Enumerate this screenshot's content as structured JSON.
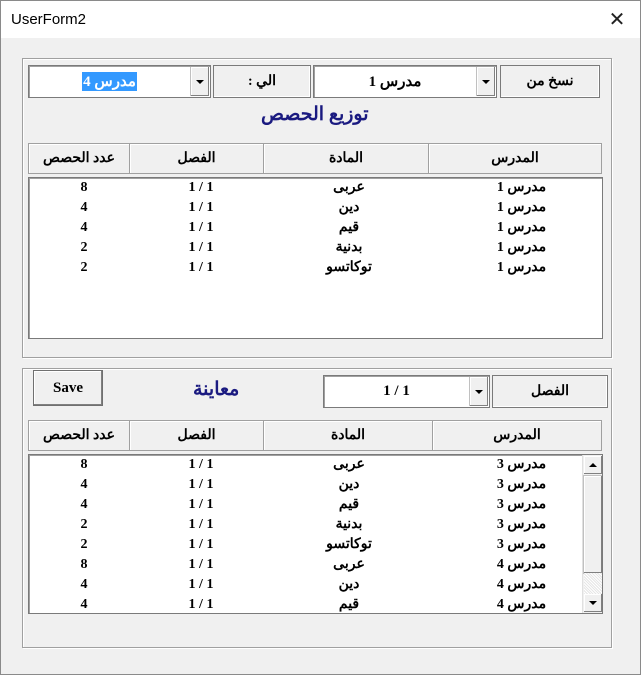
{
  "window": {
    "title": "UserForm2",
    "close_glyph": "✕"
  },
  "copy_section": {
    "copy_from_label": "نسخ من",
    "from_teacher": "مدرس 1",
    "to_label": "الي :",
    "to_teacher": "مدرس 4",
    "heading": "توزيع الحصص",
    "columns": {
      "teacher": "المدرس",
      "subject": "المادة",
      "class": "الفصل",
      "count": "عدد الحصص"
    },
    "rows": [
      {
        "teacher": "مدرس 1",
        "subject": "عربى",
        "class": "1 / 1",
        "count": "8"
      },
      {
        "teacher": "مدرس 1",
        "subject": "دين",
        "class": "1 / 1",
        "count": "4"
      },
      {
        "teacher": "مدرس 1",
        "subject": "قيم",
        "class": "1 / 1",
        "count": "4"
      },
      {
        "teacher": "مدرس 1",
        "subject": "بدنية",
        "class": "1 / 1",
        "count": "2"
      },
      {
        "teacher": "مدرس 1",
        "subject": "توكاتسو",
        "class": "1 / 1",
        "count": "2"
      }
    ]
  },
  "preview_section": {
    "save_label": "Save",
    "heading": "معاينة",
    "class_value": "1 / 1",
    "class_label": "الفصل",
    "columns": {
      "teacher": "المدرس",
      "subject": "المادة",
      "class": "الفصل",
      "count": "عدد الحصص"
    },
    "rows": [
      {
        "teacher": "مدرس 3",
        "subject": "عربى",
        "class": "1 / 1",
        "count": "8"
      },
      {
        "teacher": "مدرس 3",
        "subject": "دين",
        "class": "1 / 1",
        "count": "4"
      },
      {
        "teacher": "مدرس 3",
        "subject": "قيم",
        "class": "1 / 1",
        "count": "4"
      },
      {
        "teacher": "مدرس 3",
        "subject": "بدنية",
        "class": "1 / 1",
        "count": "2"
      },
      {
        "teacher": "مدرس 3",
        "subject": "توكاتسو",
        "class": "1 / 1",
        "count": "2"
      },
      {
        "teacher": "مدرس 4",
        "subject": "عربى",
        "class": "1 / 1",
        "count": "8"
      },
      {
        "teacher": "مدرس 4",
        "subject": "دين",
        "class": "1 / 1",
        "count": "4"
      },
      {
        "teacher": "مدرس 4",
        "subject": "قيم",
        "class": "1 / 1",
        "count": "4"
      }
    ]
  },
  "colors": {
    "heading": "#1a1a80",
    "selection": "#3399ff",
    "face": "#f0f0f0"
  }
}
